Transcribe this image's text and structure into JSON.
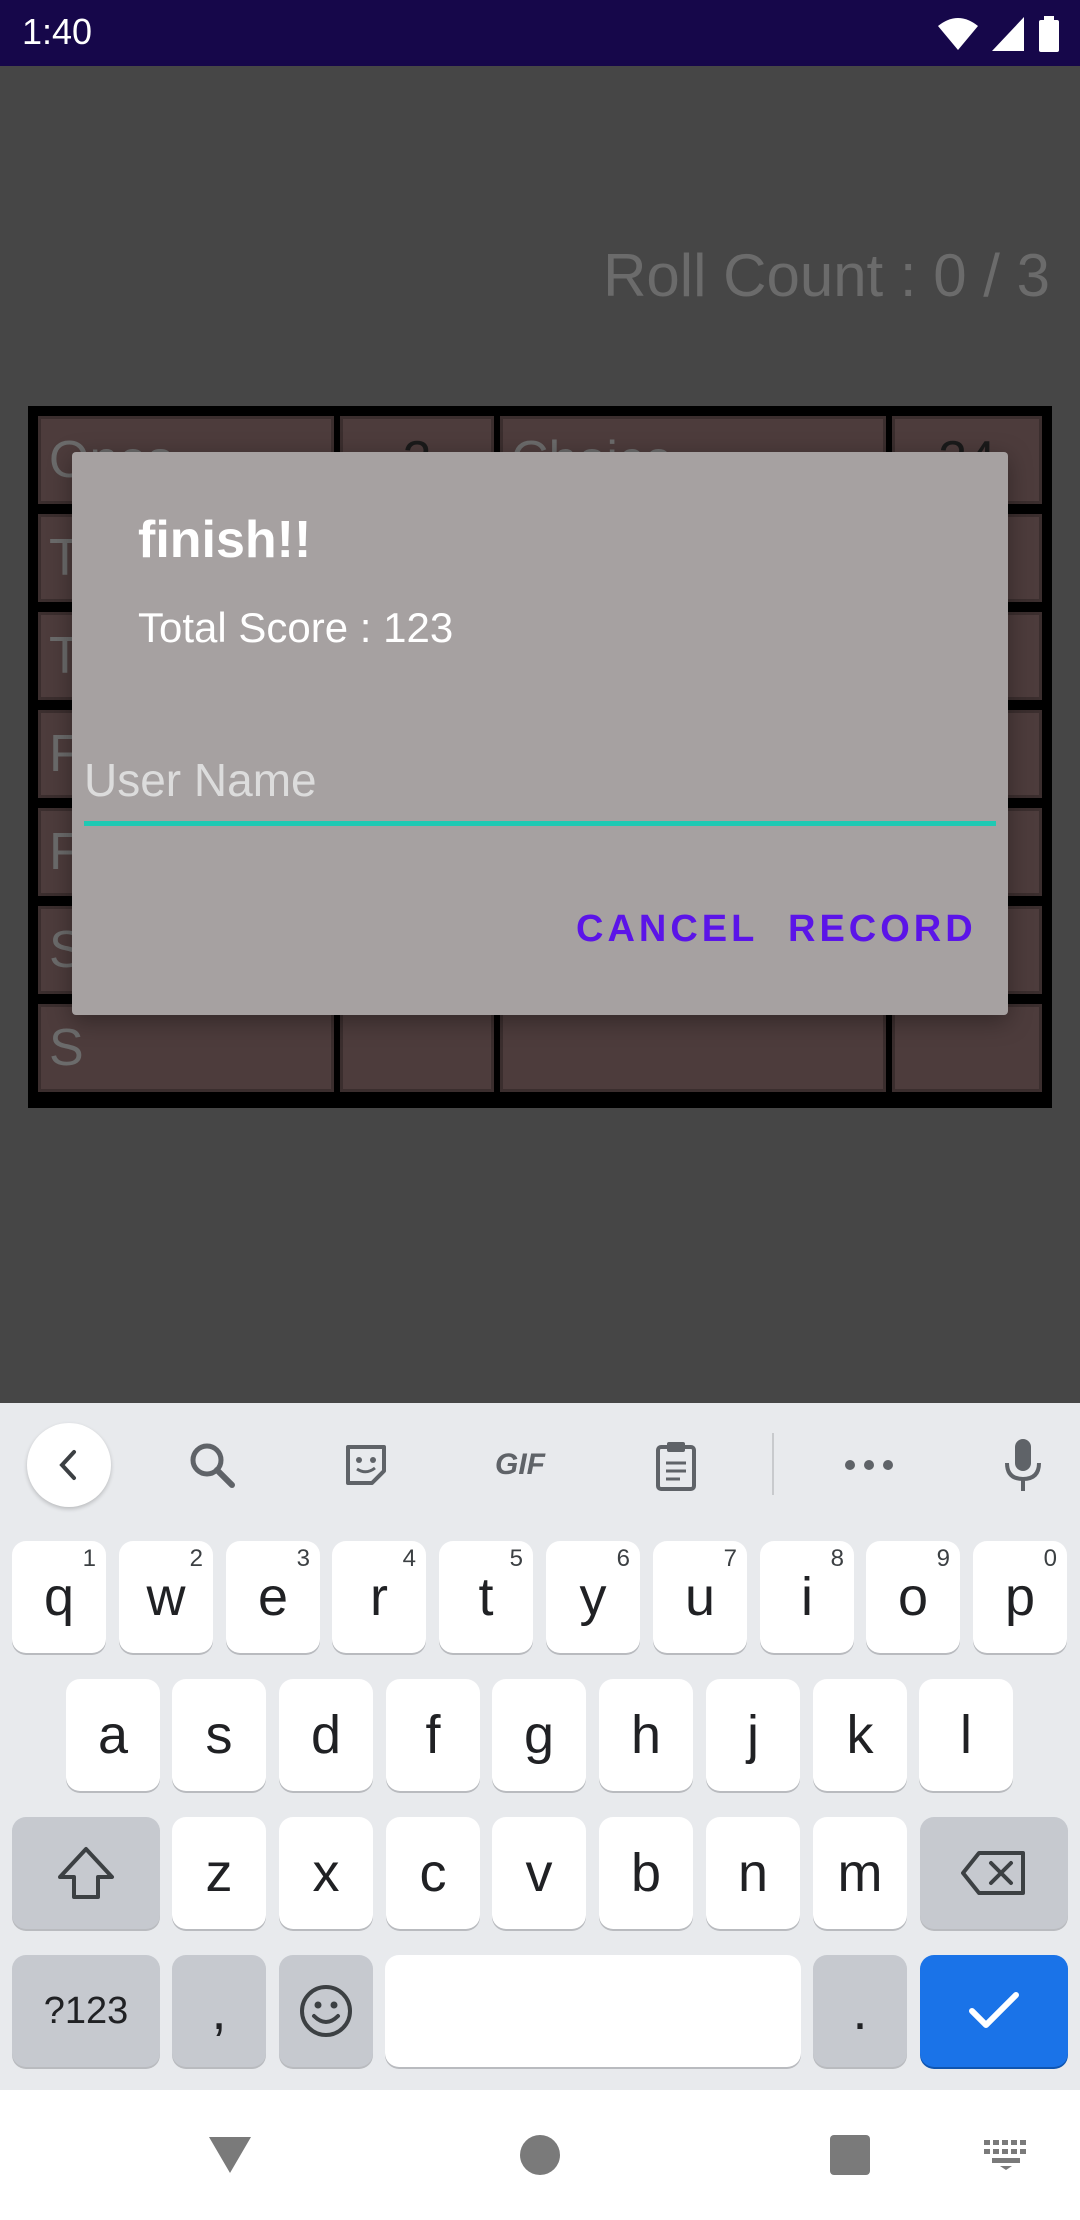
{
  "status_bar": {
    "time": "1:40"
  },
  "game": {
    "roll_count": "Roll Count : 0 / 3",
    "rows": [
      {
        "left_name": "Ones",
        "left_value": "2",
        "right_name": "Choice",
        "right_value": "24"
      },
      {
        "left_name": "T",
        "left_value": "",
        "right_name": "",
        "right_value": ""
      },
      {
        "left_name": "T",
        "left_value": "",
        "right_name": "",
        "right_value": ""
      },
      {
        "left_name": "F",
        "left_value": "",
        "right_name": "",
        "right_value": ""
      },
      {
        "left_name": "F",
        "left_value": "",
        "right_name": "",
        "right_value": ""
      },
      {
        "left_name": "S",
        "left_value": "",
        "right_name": "",
        "right_value": ""
      },
      {
        "left_name": "S",
        "left_value": "",
        "right_name": "",
        "right_value": ""
      }
    ]
  },
  "dialog": {
    "title": "finish!!",
    "message": "Total Score : 123",
    "input_placeholder": "User Name",
    "input_value": "",
    "cancel_label": "CANCEL",
    "record_label": "RECORD",
    "accent_color": "#1fc9b3",
    "button_color": "#5b14e8"
  },
  "keyboard": {
    "toolbar": [
      "chevron-left-icon",
      "search-icon",
      "sticker-icon",
      "GIF",
      "clipboard-icon",
      "more-icon",
      "mic-icon"
    ],
    "row1": [
      {
        "key": "q",
        "hint": "1"
      },
      {
        "key": "w",
        "hint": "2"
      },
      {
        "key": "e",
        "hint": "3"
      },
      {
        "key": "r",
        "hint": "4"
      },
      {
        "key": "t",
        "hint": "5"
      },
      {
        "key": "y",
        "hint": "6"
      },
      {
        "key": "u",
        "hint": "7"
      },
      {
        "key": "i",
        "hint": "8"
      },
      {
        "key": "o",
        "hint": "9"
      },
      {
        "key": "p",
        "hint": "0"
      }
    ],
    "row2": [
      "a",
      "s",
      "d",
      "f",
      "g",
      "h",
      "j",
      "k",
      "l"
    ],
    "row3": [
      "z",
      "x",
      "c",
      "v",
      "b",
      "n",
      "m"
    ],
    "symbols_label": "?123",
    "comma_label": ",",
    "period_label": ".",
    "enter_color": "#1a73e8"
  }
}
